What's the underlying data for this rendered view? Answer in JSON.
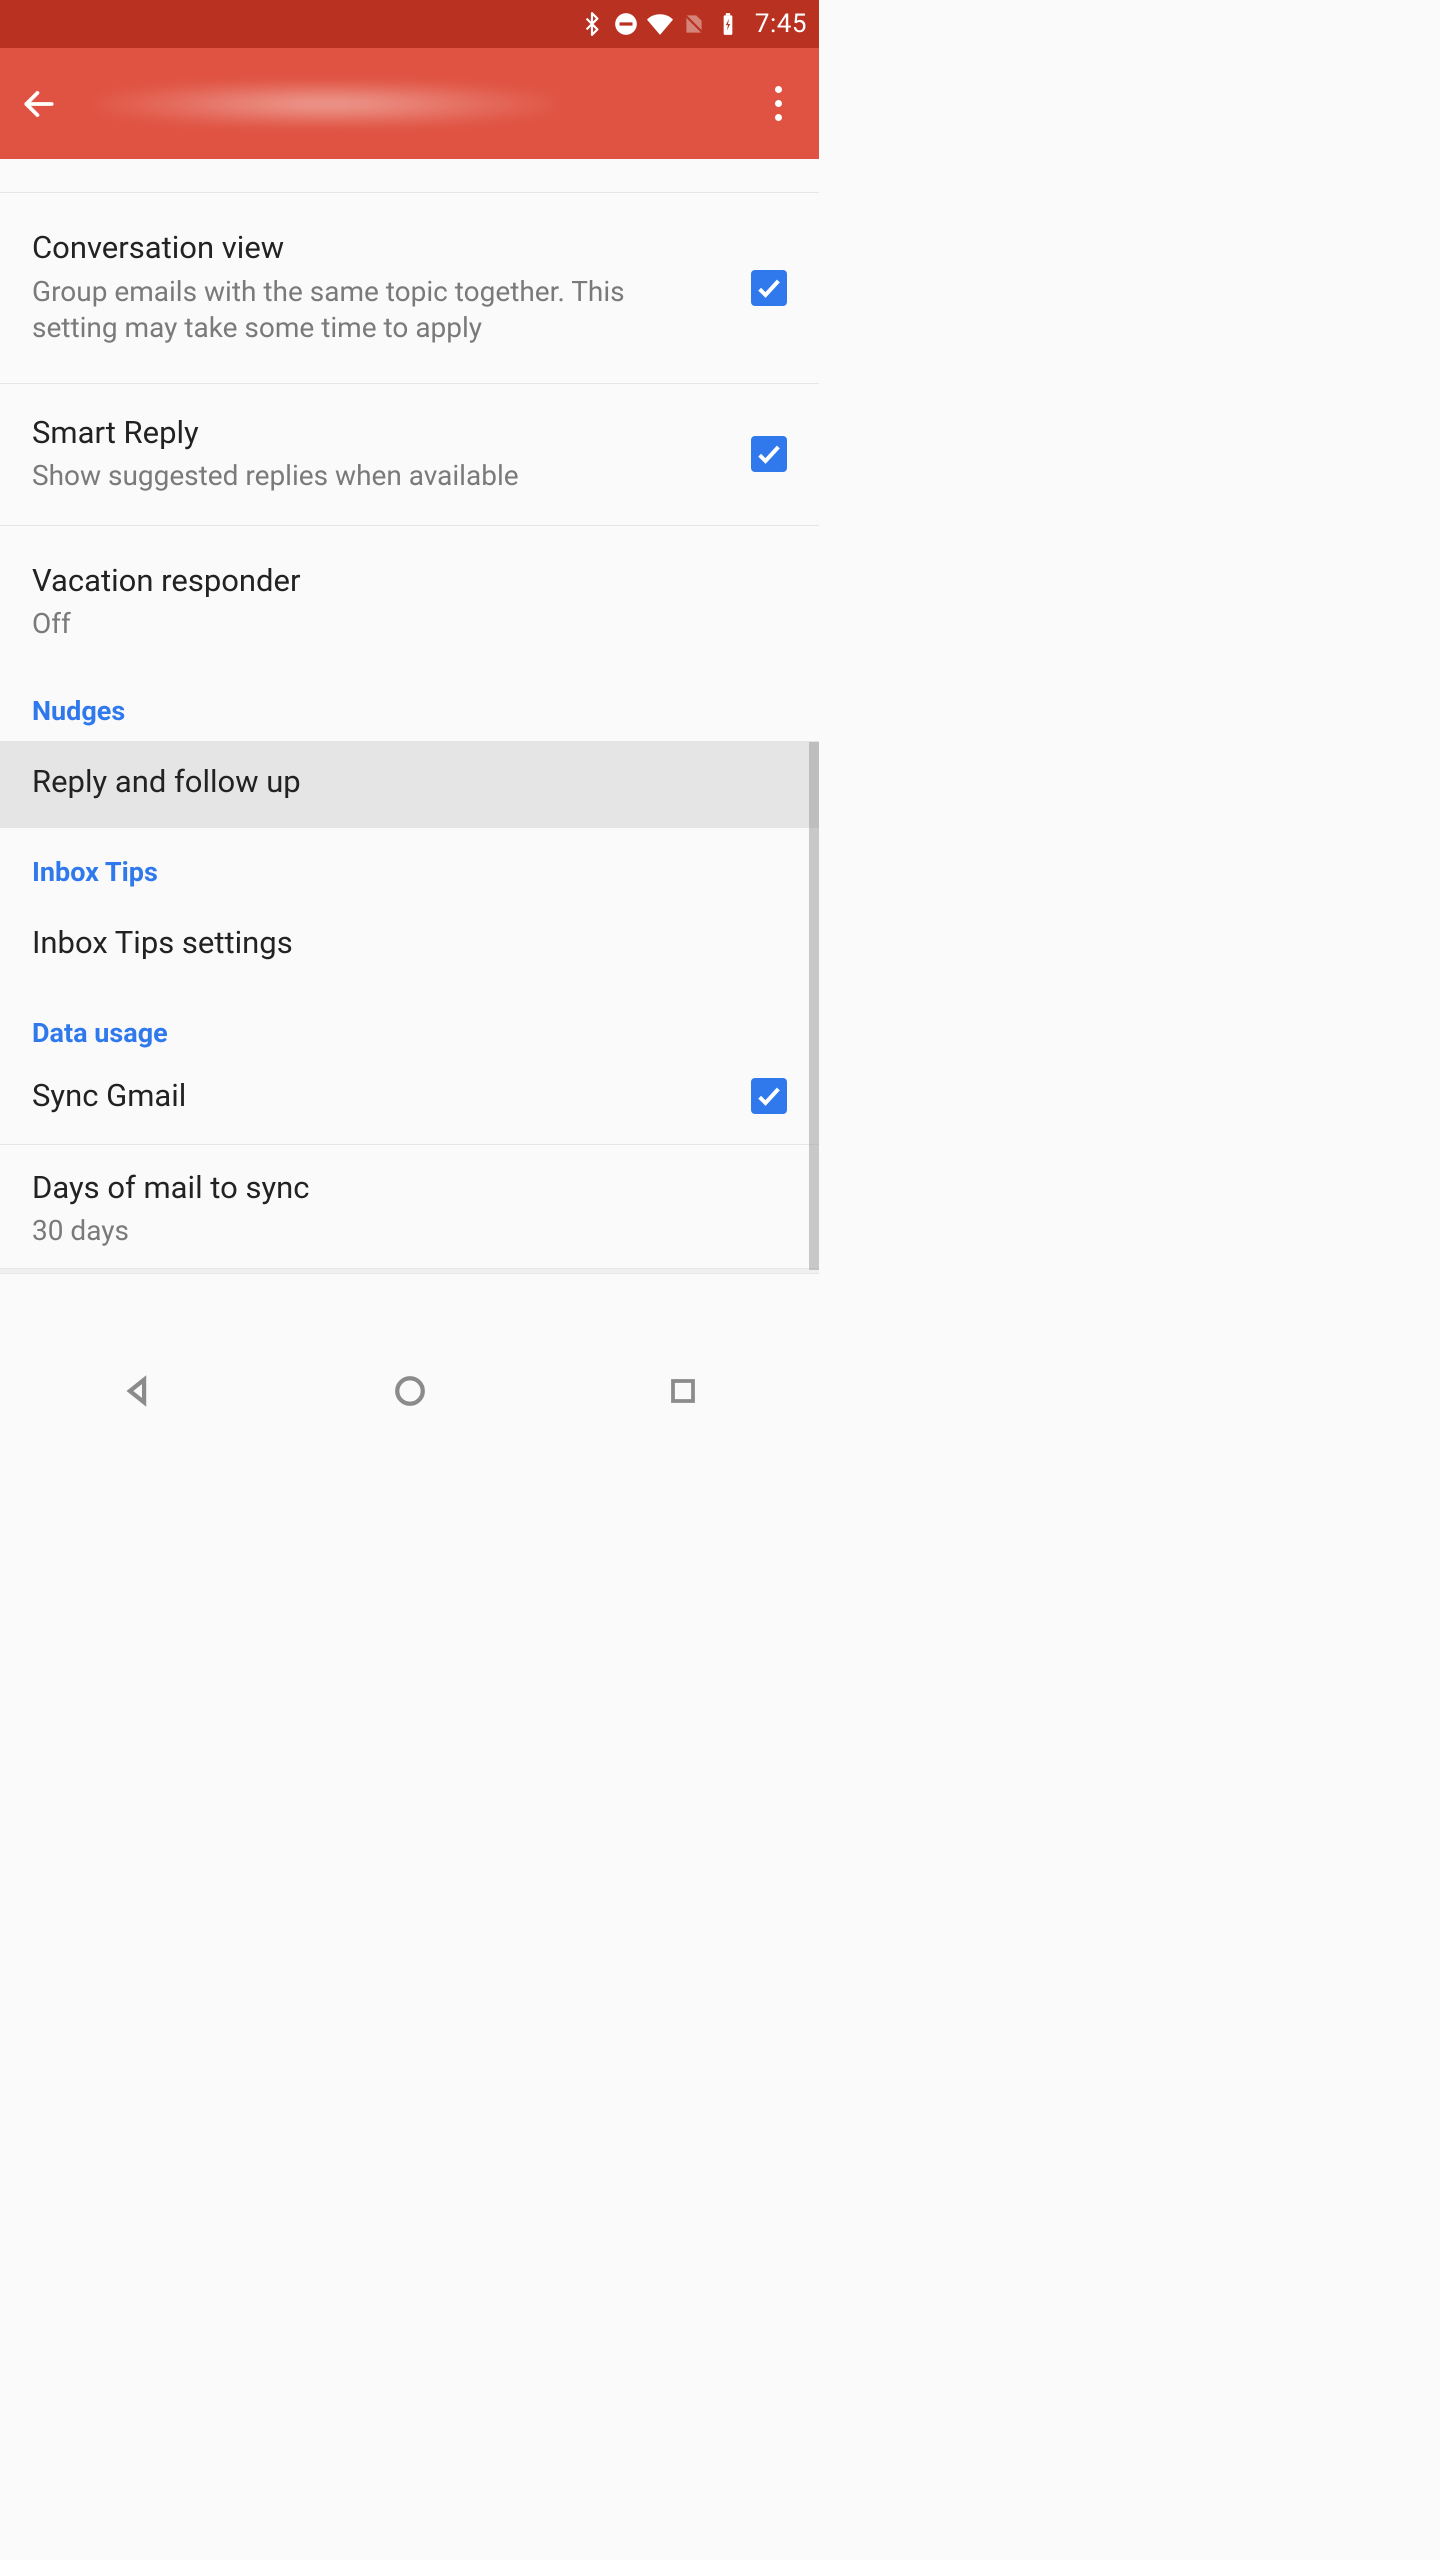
{
  "status": {
    "time": "7:45"
  },
  "appbar": {
    "title_blurred": true
  },
  "settings": {
    "conversation_view": {
      "title": "Conversation view",
      "subtitle": "Group emails with the same topic together. This setting may take some time to apply",
      "checked": true
    },
    "smart_reply": {
      "title": "Smart Reply",
      "subtitle": "Show suggested replies when available",
      "checked": true
    },
    "vacation_responder": {
      "title": "Vacation responder",
      "value": "Off"
    }
  },
  "sections": {
    "nudges": {
      "header": "Nudges",
      "items": {
        "reply_follow_up": "Reply and follow up"
      }
    },
    "inbox_tips": {
      "header": "Inbox Tips",
      "items": {
        "inbox_tips_settings": "Inbox Tips settings"
      }
    },
    "data_usage": {
      "header": "Data usage",
      "sync_gmail": {
        "title": "Sync Gmail",
        "checked": true
      },
      "days_to_sync": {
        "title": "Days of mail to sync",
        "value": "30 days"
      }
    }
  }
}
